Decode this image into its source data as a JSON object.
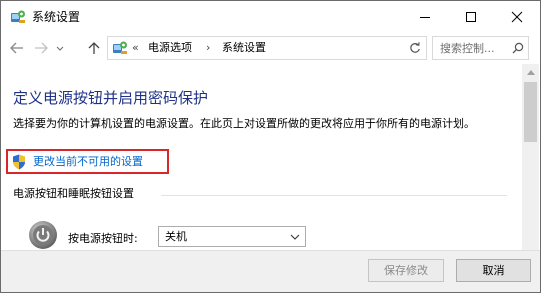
{
  "window": {
    "title": "系统设置",
    "controls": {
      "minimize": "minimize",
      "maximize": "maximize",
      "close": "close"
    }
  },
  "nav": {
    "breadcrumb_prefix": "«",
    "breadcrumb": [
      "电源选项",
      "系统设置"
    ],
    "breadcrumb_separator": "›",
    "search_placeholder": "搜索控制..."
  },
  "content": {
    "heading": "定义电源按钮并启用密码保护",
    "description": "选择要为你的计算机设置的电源设置。在此页上对设置所做的更改将应用于你所有的电源计划。",
    "change_link": "更改当前不可用的设置",
    "section_title": "电源按钮和睡眠按钮设置",
    "power_button_label": "按电源按钮时:",
    "power_button_value": "关机"
  },
  "footer": {
    "save_label": "保存修改",
    "cancel_label": "取消"
  },
  "colors": {
    "heading": "#1e3287",
    "link": "#0066cc",
    "highlight": "#d8262a",
    "footer_bg": "#f0f0f0"
  },
  "icons": [
    "control-panel-icon",
    "minimize-icon",
    "maximize-icon",
    "close-icon",
    "back-arrow-icon",
    "forward-arrow-icon",
    "chevron-down-icon",
    "up-arrow-icon",
    "refresh-icon",
    "search-icon",
    "uac-shield-icon",
    "power-icon"
  ]
}
